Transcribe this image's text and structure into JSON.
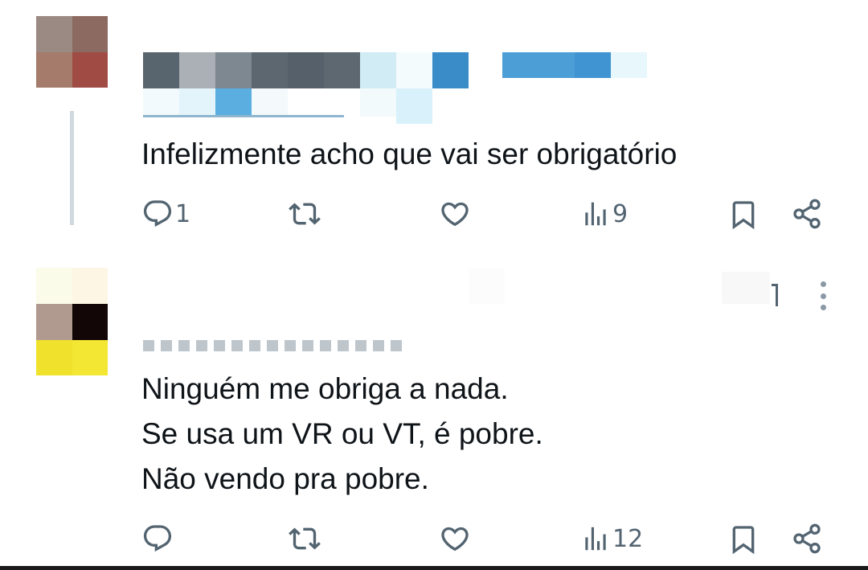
{
  "tweets": [
    {
      "text": "Infelizmente acho que vai ser obrigatório",
      "reply_count": "1",
      "view_count": "9"
    },
    {
      "lines": [
        "Ninguém me obriga a nada.",
        "Se usa um VR ou VT, é pobre.",
        "Não vendo pra pobre."
      ],
      "reply_count": "",
      "view_count": "12"
    }
  ],
  "colors": {
    "text": "#0f1419",
    "icon": "#536471",
    "thread_line": "#cfd9de"
  },
  "icons": [
    "reply-icon",
    "retweet-icon",
    "like-icon",
    "views-icon",
    "bookmark-icon",
    "share-icon",
    "more-icon"
  ]
}
